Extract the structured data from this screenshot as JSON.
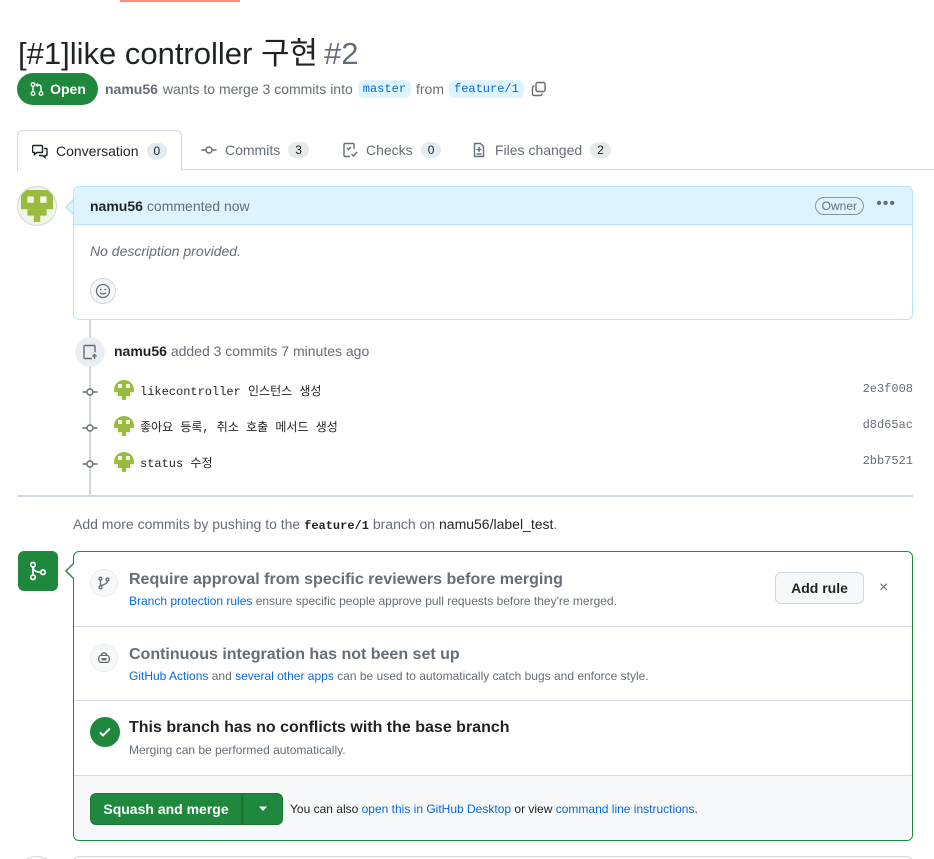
{
  "pr": {
    "title": "[#1]like controller 구현",
    "number": "#2",
    "state": "Open",
    "author": "namu56",
    "merge_text": "wants to merge 3 commits into",
    "base_branch": "master",
    "from_text": "from",
    "head_branch": "feature/1"
  },
  "tabs": [
    {
      "label": "Conversation",
      "count": "0",
      "icon": "comment-discussion-icon"
    },
    {
      "label": "Commits",
      "count": "3",
      "icon": "git-commit-icon"
    },
    {
      "label": "Checks",
      "count": "0",
      "icon": "checklist-icon"
    },
    {
      "label": "Files changed",
      "count": "2",
      "icon": "file-diff-icon"
    }
  ],
  "comment": {
    "author": "namu56",
    "action": "commented now",
    "role_badge": "Owner",
    "menu_label": "•••",
    "body": "No description provided."
  },
  "push_event": {
    "author": "namu56",
    "text": "added 3 commits 7 minutes ago"
  },
  "commits": [
    {
      "message": "likecontroller 인스턴스 생성",
      "sha": "2e3f008"
    },
    {
      "message": "좋아요 등록, 취소 호출 메서드 생성",
      "sha": "d8d65ac"
    },
    {
      "message": "status 수정",
      "sha": "2bb7521"
    }
  ],
  "hint": {
    "prefix": "Add more commits by pushing to the",
    "branch": "feature/1",
    "middle": "branch on",
    "repo": "namu56/label_test",
    "suffix": "."
  },
  "merge_box": {
    "protection": {
      "title": "Require approval from specific reviewers before merging",
      "link": "Branch protection rules",
      "text": "ensure specific people approve pull requests before they're merged.",
      "button": "Add rule",
      "dismiss": "×"
    },
    "ci": {
      "title": "Continuous integration has not been set up",
      "link1": "GitHub Actions",
      "and": "and",
      "link2": "several other apps",
      "text": "can be used to automatically catch bugs and enforce style."
    },
    "conflicts": {
      "title": "This branch has no conflicts with the base branch",
      "text": "Merging can be performed automatically."
    },
    "footer": {
      "button": "Squash and merge",
      "also": "You can also",
      "link1": "open this in GitHub Desktop",
      "or": "or view",
      "link2": "command line instructions",
      "end": "."
    }
  },
  "colors": {
    "green": "#1f883d",
    "blue_link": "#0969da",
    "comment_header": "#ddf4ff",
    "muted": "#656d76"
  }
}
